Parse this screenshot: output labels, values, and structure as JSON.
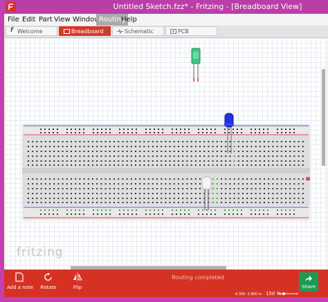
{
  "window": {
    "title": "Untitled Sketch.fzz* - Fritzing - [Breadboard View]"
  },
  "menu": {
    "items": [
      "File",
      "Edit",
      "Part",
      "View",
      "Window",
      "Routing",
      "Help"
    ],
    "active": "Routing"
  },
  "tabs": [
    {
      "label": "Welcome",
      "icon": "fritzing-f-icon"
    },
    {
      "label": "Breadboard",
      "icon": "breadboard-icon",
      "active": true
    },
    {
      "label": "Schematic",
      "icon": "schematic-icon"
    },
    {
      "label": "PCB",
      "icon": "pcb-icon"
    }
  ],
  "canvas": {
    "watermark": "fritzing"
  },
  "toolbar": {
    "add_note": "Add a note",
    "rotate": "Rotate",
    "flip": "Flip",
    "share": "Share",
    "status": "Routing completed",
    "coords": "6.356 -1.800 in",
    "zoom": "150 %"
  },
  "colors": {
    "titlebar": "#ba3ea8",
    "toolbar": "#d63224",
    "active_tab": "#d43a2a",
    "share_button": "#1d9a55",
    "led_green": "#3ec488",
    "led_blue": "#2233dd",
    "led_white": "#f5f5f5"
  }
}
